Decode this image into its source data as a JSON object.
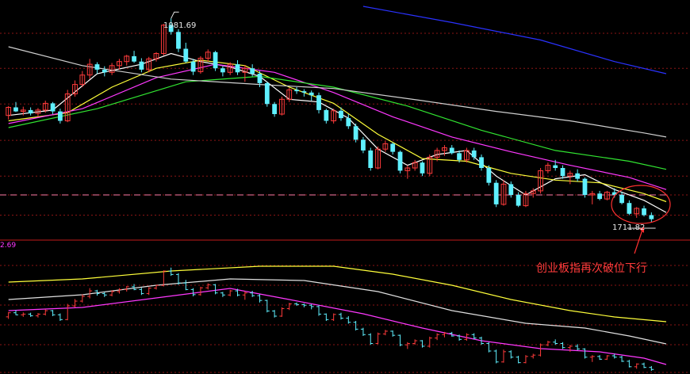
{
  "chart_data": [
    {
      "type": "candlestick",
      "panel": "price",
      "colors": {
        "up": "#ff3b3b",
        "down": "#5ff0ff",
        "ma5": "#ffffff",
        "ma10": "#ffff3a",
        "ma20": "#ff38ff",
        "ma30": "#31e531",
        "ma60": "#d0d0d0",
        "ma120": "#2a32ff",
        "grid": "#8b1515",
        "dash": "#ff7aa6"
      },
      "ylim": [
        1680,
        2000
      ],
      "annotations": {
        "high_label": "1981.69",
        "low_label": "1711.82"
      },
      "gridlines": [
        1960,
        1908,
        1855,
        1801,
        1748,
        1720,
        1690
      ],
      "dashed_line_value": 1720,
      "candles": [
        [
          1838,
          1852,
          1832,
          1850
        ],
        [
          1850,
          1858,
          1843,
          1844
        ],
        [
          1844,
          1851,
          1838,
          1846
        ],
        [
          1846,
          1850,
          1838,
          1841
        ],
        [
          1841,
          1849,
          1836,
          1846
        ],
        [
          1846,
          1860,
          1842,
          1856
        ],
        [
          1856,
          1858,
          1840,
          1844
        ],
        [
          1844,
          1848,
          1826,
          1830
        ],
        [
          1830,
          1876,
          1828,
          1870
        ],
        [
          1870,
          1890,
          1866,
          1884
        ],
        [
          1884,
          1904,
          1880,
          1898
        ],
        [
          1898,
          1922,
          1892,
          1914
        ],
        [
          1914,
          1917,
          1900,
          1906
        ],
        [
          1906,
          1911,
          1896,
          1902
        ],
        [
          1902,
          1916,
          1898,
          1912
        ],
        [
          1912,
          1922,
          1906,
          1918
        ],
        [
          1918,
          1928,
          1912,
          1926
        ],
        [
          1926,
          1934,
          1916,
          1918
        ],
        [
          1918,
          1923,
          1902,
          1906
        ],
        [
          1906,
          1925,
          1902,
          1922
        ],
        [
          1922,
          1932,
          1918,
          1930
        ],
        [
          1930,
          1974,
          1927,
          1972
        ],
        [
          1972,
          1982,
          1958,
          1962
        ],
        [
          1962,
          1966,
          1932,
          1937
        ],
        [
          1937,
          1946,
          1916,
          1918
        ],
        [
          1918,
          1922,
          1898,
          1903
        ],
        [
          1903,
          1926,
          1900,
          1923
        ],
        [
          1923,
          1936,
          1918,
          1932
        ],
        [
          1932,
          1934,
          1904,
          1908
        ],
        [
          1908,
          1911,
          1896,
          1902
        ],
        [
          1902,
          1917,
          1898,
          1914
        ],
        [
          1914,
          1920,
          1898,
          1902
        ],
        [
          1902,
          1913,
          1888,
          1908
        ],
        [
          1908,
          1914,
          1896,
          1900
        ],
        [
          1900,
          1904,
          1880,
          1886
        ],
        [
          1886,
          1888,
          1851,
          1855
        ],
        [
          1855,
          1858,
          1836,
          1840
        ],
        [
          1840,
          1866,
          1838,
          1862
        ],
        [
          1862,
          1879,
          1858,
          1876
        ],
        [
          1876,
          1880,
          1870,
          1874
        ],
        [
          1874,
          1877,
          1866,
          1872
        ],
        [
          1872,
          1875,
          1860,
          1868
        ],
        [
          1868,
          1872,
          1841,
          1846
        ],
        [
          1846,
          1848,
          1826,
          1830
        ],
        [
          1830,
          1848,
          1826,
          1845
        ],
        [
          1845,
          1850,
          1830,
          1834
        ],
        [
          1834,
          1840,
          1818,
          1822
        ],
        [
          1822,
          1826,
          1798,
          1802
        ],
        [
          1802,
          1806,
          1782,
          1786
        ],
        [
          1786,
          1790,
          1756,
          1760
        ],
        [
          1760,
          1792,
          1758,
          1788
        ],
        [
          1788,
          1800,
          1784,
          1796
        ],
        [
          1796,
          1798,
          1780,
          1784
        ],
        [
          1784,
          1786,
          1752,
          1756
        ],
        [
          1756,
          1764,
          1744,
          1760
        ],
        [
          1760,
          1772,
          1756,
          1768
        ],
        [
          1768,
          1770,
          1748,
          1752
        ],
        [
          1752,
          1780,
          1748,
          1776
        ],
        [
          1776,
          1790,
          1770,
          1786
        ],
        [
          1786,
          1794,
          1778,
          1790
        ],
        [
          1790,
          1794,
          1780,
          1782
        ],
        [
          1782,
          1786,
          1768,
          1772
        ],
        [
          1772,
          1790,
          1768,
          1786
        ],
        [
          1786,
          1790,
          1772,
          1776
        ],
        [
          1776,
          1780,
          1756,
          1760
        ],
        [
          1760,
          1764,
          1734,
          1738
        ],
        [
          1738,
          1742,
          1702,
          1706
        ],
        [
          1706,
          1742,
          1704,
          1736
        ],
        [
          1736,
          1740,
          1716,
          1720
        ],
        [
          1720,
          1724,
          1702,
          1704
        ],
        [
          1704,
          1726,
          1702,
          1722
        ],
        [
          1722,
          1730,
          1716,
          1726
        ],
        [
          1726,
          1760,
          1722,
          1756
        ],
        [
          1756,
          1768,
          1752,
          1764
        ],
        [
          1764,
          1772,
          1756,
          1760
        ],
        [
          1760,
          1764,
          1744,
          1748
        ],
        [
          1748,
          1756,
          1736,
          1752
        ],
        [
          1752,
          1758,
          1740,
          1744
        ],
        [
          1744,
          1746,
          1716,
          1720
        ],
        [
          1720,
          1726,
          1706,
          1722
        ],
        [
          1722,
          1726,
          1712,
          1714
        ],
        [
          1714,
          1726,
          1712,
          1724
        ],
        [
          1724,
          1730,
          1716,
          1720
        ],
        [
          1720,
          1724,
          1706,
          1708
        ],
        [
          1708,
          1712,
          1690,
          1692
        ],
        [
          1692,
          1702,
          1686,
          1700
        ],
        [
          1700,
          1704,
          1688,
          1690
        ],
        [
          1690,
          1694,
          1680,
          1684
        ]
      ],
      "series": [
        {
          "key": "ma5",
          "points": [
            [
              0,
              1838
            ],
            [
              6,
              1846
            ],
            [
              12,
              1900
            ],
            [
              18,
              1914
            ],
            [
              22,
              1930
            ],
            [
              26,
              1918
            ],
            [
              30,
              1910
            ],
            [
              34,
              1896
            ],
            [
              38,
              1862
            ],
            [
              42,
              1858
            ],
            [
              46,
              1834
            ],
            [
              50,
              1788
            ],
            [
              54,
              1764
            ],
            [
              58,
              1780
            ],
            [
              62,
              1786
            ],
            [
              66,
              1748
            ],
            [
              70,
              1720
            ],
            [
              74,
              1744
            ],
            [
              78,
              1750
            ],
            [
              82,
              1728
            ],
            [
              86,
              1712
            ],
            [
              89,
              1694
            ]
          ]
        },
        {
          "key": "ma10",
          "points": [
            [
              0,
              1830
            ],
            [
              8,
              1842
            ],
            [
              14,
              1880
            ],
            [
              20,
              1908
            ],
            [
              26,
              1920
            ],
            [
              32,
              1912
            ],
            [
              38,
              1880
            ],
            [
              44,
              1856
            ],
            [
              50,
              1810
            ],
            [
              56,
              1774
            ],
            [
              62,
              1770
            ],
            [
              68,
              1752
            ],
            [
              74,
              1742
            ],
            [
              80,
              1738
            ],
            [
              86,
              1722
            ],
            [
              89,
              1710
            ]
          ]
        },
        {
          "key": "ma20",
          "points": [
            [
              0,
              1826
            ],
            [
              10,
              1848
            ],
            [
              20,
              1894
            ],
            [
              28,
              1914
            ],
            [
              36,
              1902
            ],
            [
              44,
              1872
            ],
            [
              52,
              1836
            ],
            [
              60,
              1806
            ],
            [
              68,
              1784
            ],
            [
              76,
              1764
            ],
            [
              84,
              1746
            ],
            [
              89,
              1728
            ]
          ]
        },
        {
          "key": "ma30",
          "points": [
            [
              0,
              1820
            ],
            [
              12,
              1848
            ],
            [
              24,
              1888
            ],
            [
              34,
              1896
            ],
            [
              44,
              1880
            ],
            [
              54,
              1852
            ],
            [
              64,
              1816
            ],
            [
              74,
              1786
            ],
            [
              84,
              1770
            ],
            [
              89,
              1758
            ]
          ]
        },
        {
          "key": "ma60",
          "points": [
            [
              0,
              1940
            ],
            [
              10,
              1912
            ],
            [
              22,
              1892
            ],
            [
              34,
              1884
            ],
            [
              44,
              1878
            ],
            [
              56,
              1860
            ],
            [
              66,
              1844
            ],
            [
              76,
              1830
            ],
            [
              86,
              1812
            ],
            [
              89,
              1806
            ]
          ]
        },
        {
          "key": "ma120",
          "points": [
            [
              48,
              2000
            ],
            [
              60,
              1976
            ],
            [
              72,
              1950
            ],
            [
              82,
              1918
            ],
            [
              89,
              1900
            ]
          ]
        }
      ]
    },
    {
      "type": "bar",
      "panel": "indicator",
      "label": "2.69",
      "note": "创业板指再次破位下行"
    }
  ]
}
